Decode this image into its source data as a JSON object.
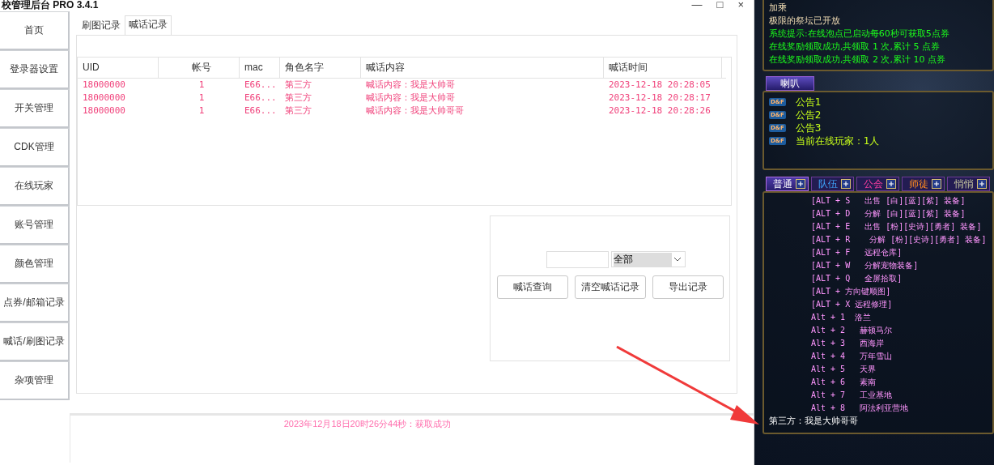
{
  "window": {
    "title": "校管理后台 PRO 3.4.1",
    "controls": [
      "—",
      "□",
      "×"
    ]
  },
  "sidebar": {
    "items": [
      "首页",
      "登录器设置",
      "开关管理",
      "CDK管理",
      "在线玩家",
      "账号管理",
      "颜色管理",
      "点券/邮箱记录",
      "喊话/刷图记录",
      "杂项管理"
    ]
  },
  "tabs": [
    {
      "label": "刷图记录",
      "selected": false
    },
    {
      "label": "喊话记录",
      "selected": true
    }
  ],
  "table": {
    "columns": [
      "UID",
      "帐号",
      "mac",
      "角色名字",
      "喊话内容",
      "喊话时间"
    ],
    "rows": [
      [
        "18000000",
        "1",
        "E66...",
        "第三方",
        "喊话内容：我是大帅哥",
        "2023-12-18 20:28:05"
      ],
      [
        "18000000",
        "1",
        "E66...",
        "第三方",
        "喊话内容：我是大帅哥",
        "2023-12-18 20:28:17"
      ],
      [
        "18000000",
        "1",
        "E66...",
        "第三方",
        "喊话内容：我是大帅哥哥",
        "2023-12-18 20:28:26"
      ]
    ]
  },
  "filter": {
    "select_value": "全部",
    "buttons": [
      "喊话查询",
      "清空喊话记录",
      "导出记录"
    ]
  },
  "status": "2023年12月18日20时26分44秒：获取成功",
  "game": {
    "messages": [
      {
        "kind": "notice",
        "text": "加乘"
      },
      {
        "kind": "notice",
        "text": "极限的祭坛已开放"
      },
      {
        "kind": "system",
        "text": "系统提示:在线泡点已启动每60秒可获取5点券"
      },
      {
        "kind": "system",
        "text": "在线奖励领取成功,共领取 1 次,累计 5 点券"
      },
      {
        "kind": "system",
        "text": "在线奖励领取成功,共领取 2 次,累计 10 点券"
      }
    ],
    "horn_tab": "喇叭",
    "announcements": [
      {
        "badge": "D&F",
        "text": "公告1"
      },
      {
        "badge": "D&F",
        "text": "公告2"
      },
      {
        "badge": "D&F",
        "text": "公告3"
      },
      {
        "badge": "D&F",
        "text": "当前在线玩家：1人"
      }
    ],
    "chat_tabs": [
      {
        "label": "普通",
        "selected": true,
        "kind": "normal"
      },
      {
        "label": "队伍",
        "selected": false,
        "kind": "team"
      },
      {
        "label": "公会",
        "selected": false,
        "kind": "guild"
      },
      {
        "label": "师徒",
        "selected": false,
        "kind": "mentor"
      },
      {
        "label": "悄悄",
        "selected": false,
        "kind": "whisper"
      }
    ],
    "chat": [
      {
        "kind": "shortcut",
        "text": "[ALT + S   出售 [白][蓝][紫] 装备]"
      },
      {
        "kind": "shortcut",
        "text": "[ALT + D   分解 [白][蓝][紫] 装备]"
      },
      {
        "kind": "shortcut",
        "text": "[ALT + E   出售 [粉][史诗][勇者] 装备]"
      },
      {
        "kind": "shortcut",
        "text": "[ALT + R    分解 [粉][史诗][勇者] 装备]"
      },
      {
        "kind": "shortcut",
        "text": "[ALT + F   远程仓库]"
      },
      {
        "kind": "shortcut",
        "text": "[ALT + W   分解宠物装备]"
      },
      {
        "kind": "shortcut",
        "text": "[ALT + Q   全屏拾取]"
      },
      {
        "kind": "shortcut",
        "text": "[ALT + 方向键顺图]"
      },
      {
        "kind": "shortcut",
        "text": "[ALT + X 远程修理]"
      },
      {
        "kind": "shortcut",
        "text": "Alt + 1  洛兰"
      },
      {
        "kind": "shortcut",
        "text": "Alt + 2   赫顿马尔"
      },
      {
        "kind": "shortcut",
        "text": "Alt + 3   西海岸"
      },
      {
        "kind": "shortcut",
        "text": "Alt + 4   万年雪山"
      },
      {
        "kind": "shortcut",
        "text": "Alt + 5   天界"
      },
      {
        "kind": "shortcut",
        "text": "Alt + 6   素南"
      },
      {
        "kind": "shortcut",
        "text": "Alt + 7   工业基地"
      },
      {
        "kind": "shortcut",
        "text": "Alt + 8   阿法利亚营地"
      },
      {
        "kind": "chat",
        "text": "第三方：我是大帅哥哥"
      }
    ]
  }
}
